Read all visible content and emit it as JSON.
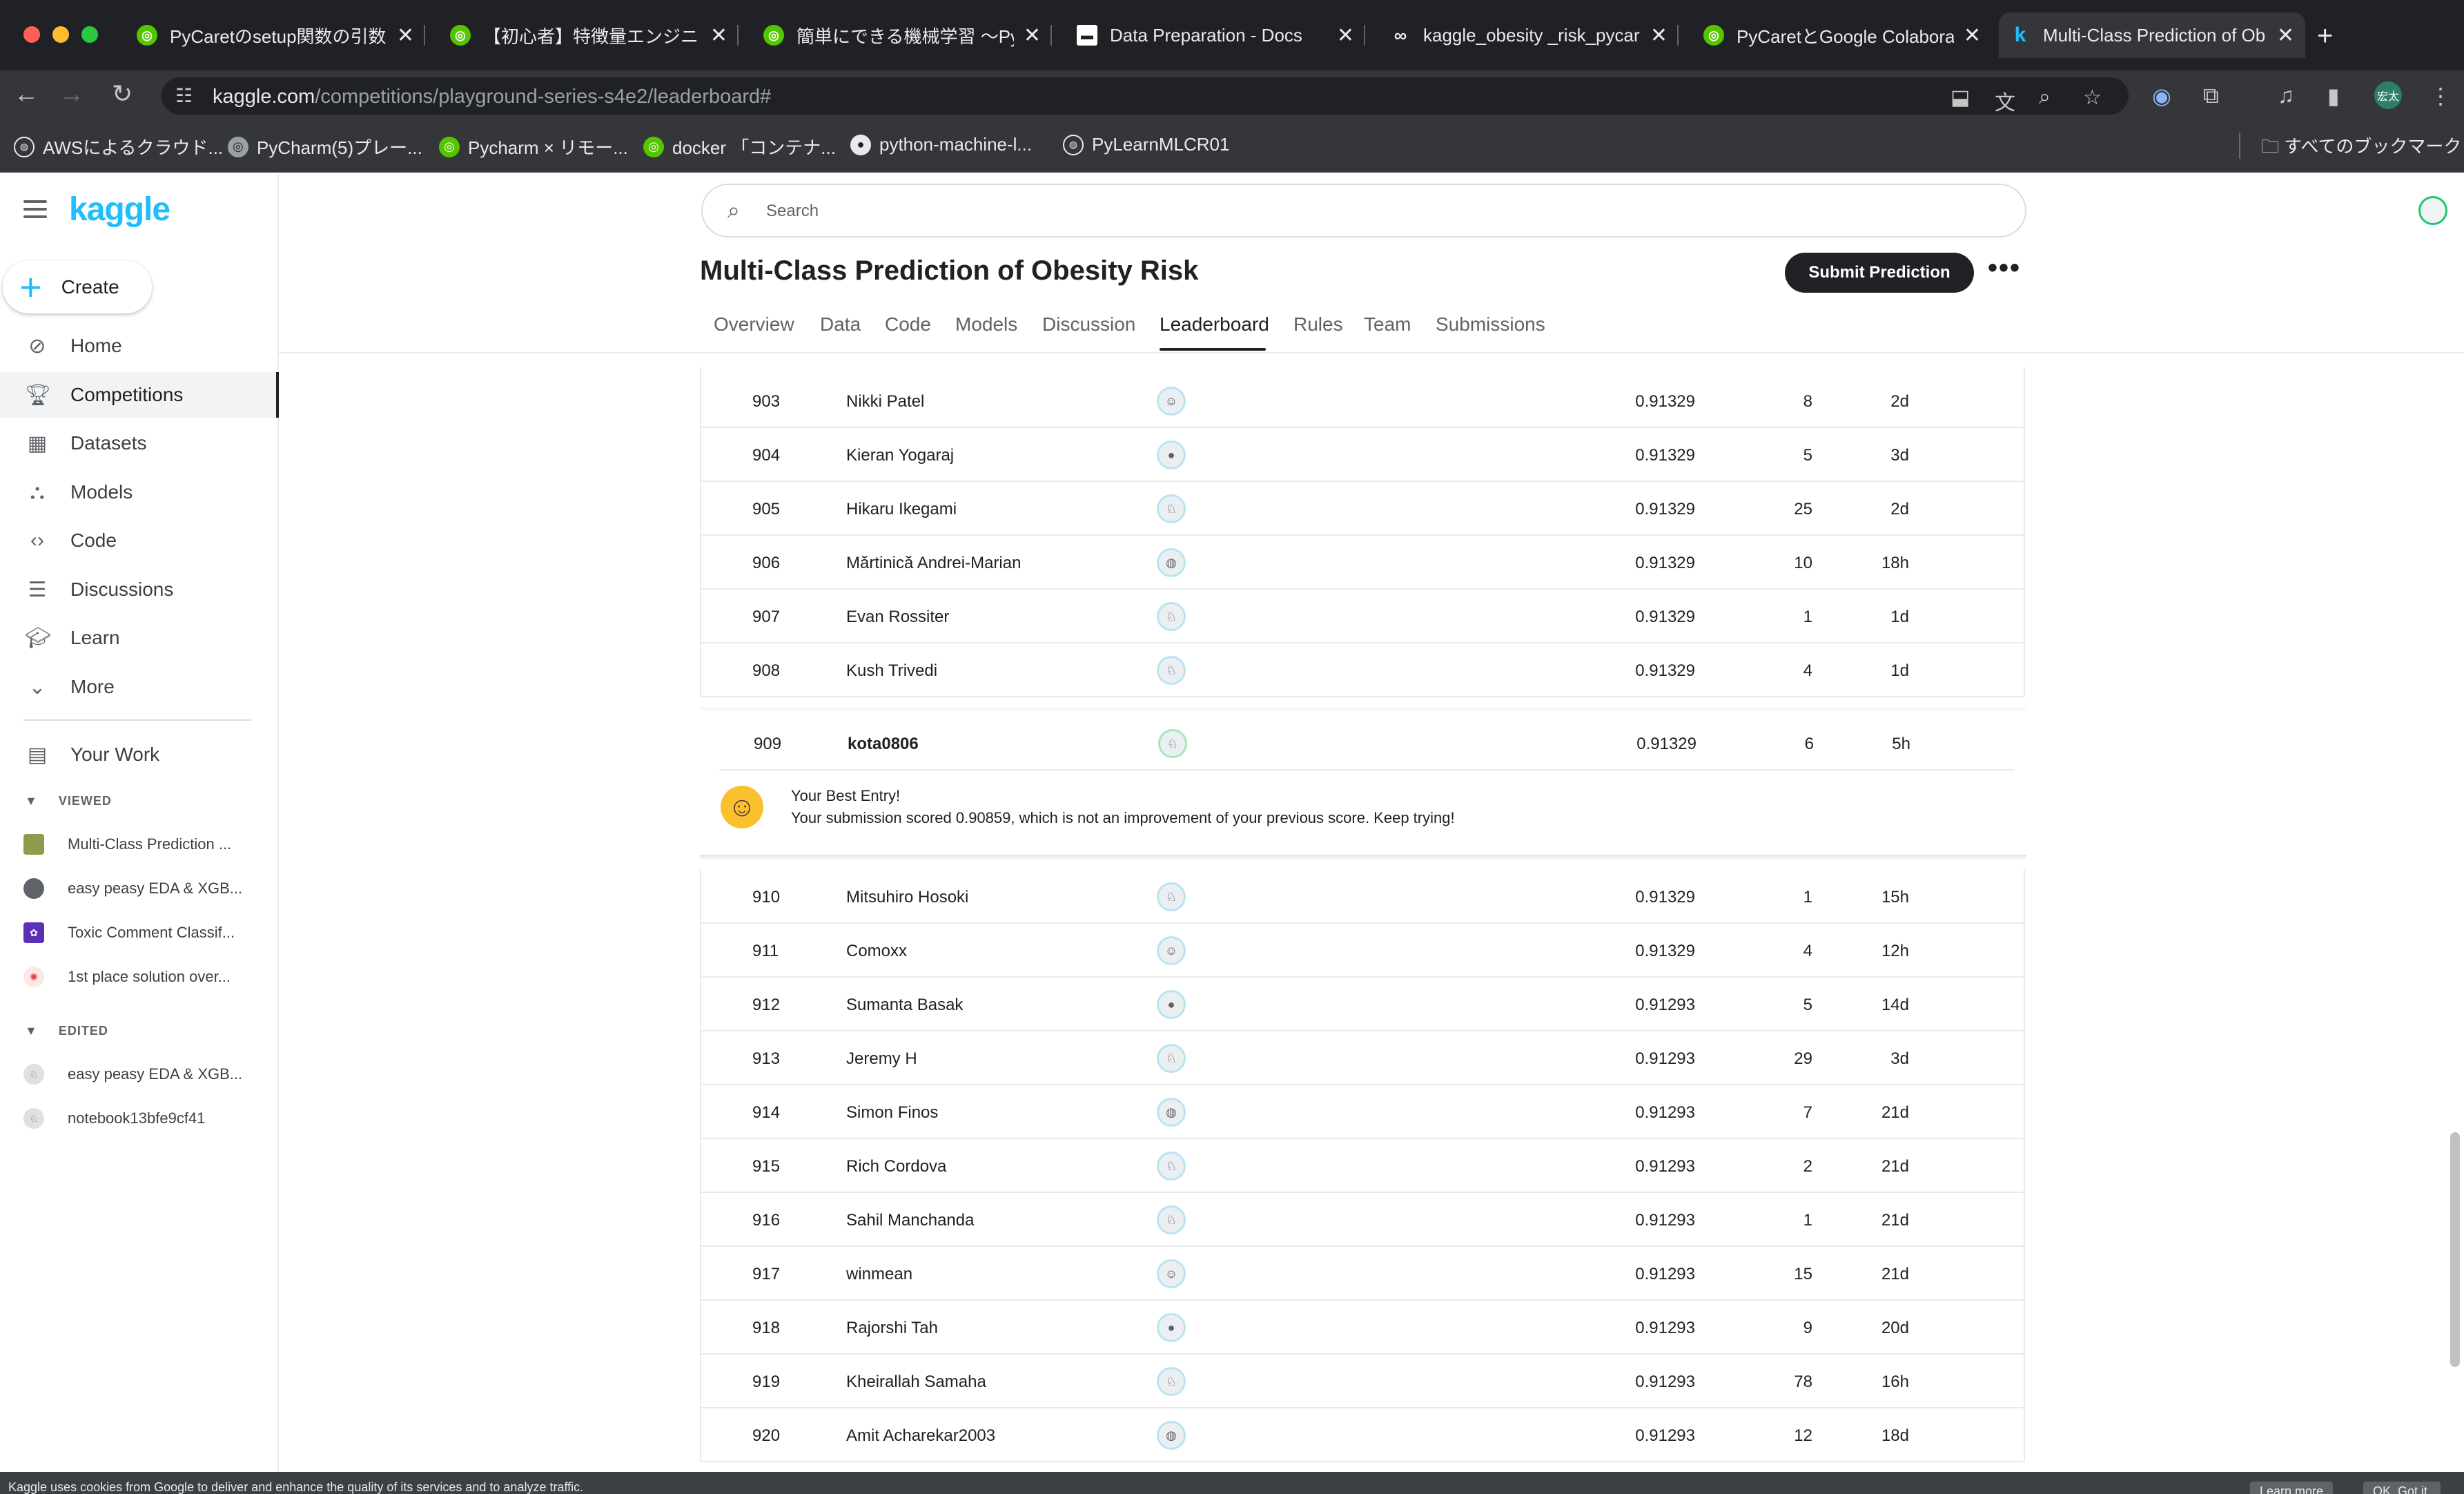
{
  "browser": {
    "tabs": [
      {
        "title": "PyCaretのsetup関数の引数に",
        "favicon": "green-circle"
      },
      {
        "title": "【初心者】特徴量エンジニアリ",
        "favicon": "green-circle"
      },
      {
        "title": "簡単にできる機械学習 〜PyCa",
        "favicon": "green-circle"
      },
      {
        "title": "Data Preparation - Docs",
        "favicon": "doc-square"
      },
      {
        "title": "kaggle_obesity _risk_pycar",
        "favicon": "colab-infinity"
      },
      {
        "title": "PyCaretとGoogle Colaborat",
        "favicon": "green-circle"
      },
      {
        "title": "Multi-Class Prediction of Ob",
        "favicon": "kaggle-k"
      }
    ],
    "url_host": "kaggle.com",
    "url_path": "/competitions/playground-series-s4e2/leaderboard#",
    "profile_initials": "宏太",
    "bookmarks": [
      {
        "label": "AWSによるクラウド..."
      },
      {
        "label": "PyCharm(5)プレー..."
      },
      {
        "label": "Pycharm × リモー..."
      },
      {
        "label": "docker 「コンテナ..."
      },
      {
        "label": "python-machine-l..."
      },
      {
        "label": "PyLearnMLCR01"
      }
    ],
    "all_bookmarks": "すべてのブックマーク"
  },
  "sidebar": {
    "logo": "kaggle",
    "create_label": "Create",
    "nav": [
      {
        "label": "Home",
        "icon": "compass-icon"
      },
      {
        "label": "Competitions",
        "icon": "trophy-icon"
      },
      {
        "label": "Datasets",
        "icon": "table-icon"
      },
      {
        "label": "Models",
        "icon": "models-icon"
      },
      {
        "label": "Code",
        "icon": "code-icon"
      },
      {
        "label": "Discussions",
        "icon": "discussion-icon"
      },
      {
        "label": "Learn",
        "icon": "learn-icon"
      },
      {
        "label": "More",
        "icon": "chevron-down-icon"
      }
    ],
    "your_work": "Your Work",
    "viewed_header": "VIEWED",
    "viewed": [
      "Multi-Class Prediction ...",
      "easy peasy EDA & XGB...",
      "Toxic Comment Classif...",
      "1st place solution over..."
    ],
    "edited_header": "EDITED",
    "edited": [
      "easy peasy EDA & XGB...",
      "notebook13bfe9cf41"
    ]
  },
  "header": {
    "search_placeholder": "Search",
    "title": "Multi-Class Prediction of Obesity Risk",
    "submit_label": "Submit Prediction",
    "more_label": "•••",
    "tabs": [
      "Overview",
      "Data",
      "Code",
      "Models",
      "Discussion",
      "Leaderboard",
      "Rules",
      "Team",
      "Submissions"
    ],
    "active_tab": "Leaderboard"
  },
  "leaderboard": {
    "rows_before": [
      {
        "rank": "903",
        "team": "Nikki Patel",
        "score": "0.91329",
        "entries": "8",
        "last": "2d"
      },
      {
        "rank": "904",
        "team": "Kieran Yogaraj",
        "score": "0.91329",
        "entries": "5",
        "last": "3d"
      },
      {
        "rank": "905",
        "team": "Hikaru Ikegami",
        "score": "0.91329",
        "entries": "25",
        "last": "2d"
      },
      {
        "rank": "906",
        "team": "Mărtinică Andrei-Marian",
        "score": "0.91329",
        "entries": "10",
        "last": "18h"
      },
      {
        "rank": "907",
        "team": "Evan Rossiter",
        "score": "0.91329",
        "entries": "1",
        "last": "1d"
      },
      {
        "rank": "908",
        "team": "Kush Trivedi",
        "score": "0.91329",
        "entries": "4",
        "last": "1d"
      }
    ],
    "my_entry": {
      "rank": "909",
      "team": "kota0806",
      "score": "0.91329",
      "entries": "6",
      "last": "5h",
      "best_label": "Your Best Entry!",
      "message": "Your submission scored 0.90859, which is not an improvement of your previous score. Keep trying!"
    },
    "rows_after": [
      {
        "rank": "910",
        "team": "Mitsuhiro Hosoki",
        "score": "0.91329",
        "entries": "1",
        "last": "15h"
      },
      {
        "rank": "911",
        "team": "Comoxx",
        "score": "0.91329",
        "entries": "4",
        "last": "12h"
      },
      {
        "rank": "912",
        "team": "Sumanta Basak",
        "score": "0.91293",
        "entries": "5",
        "last": "14d"
      },
      {
        "rank": "913",
        "team": "Jeremy H",
        "score": "0.91293",
        "entries": "29",
        "last": "3d"
      },
      {
        "rank": "914",
        "team": "Simon Finos",
        "score": "0.91293",
        "entries": "7",
        "last": "21d"
      },
      {
        "rank": "915",
        "team": "Rich Cordova",
        "score": "0.91293",
        "entries": "2",
        "last": "21d"
      },
      {
        "rank": "916",
        "team": "Sahil Manchanda",
        "score": "0.91293",
        "entries": "1",
        "last": "21d"
      },
      {
        "rank": "917",
        "team": "winmean",
        "score": "0.91293",
        "entries": "15",
        "last": "21d"
      },
      {
        "rank": "918",
        "team": "Rajorshi Tah",
        "score": "0.91293",
        "entries": "9",
        "last": "20d"
      },
      {
        "rank": "919",
        "team": "Kheirallah Samaha",
        "score": "0.91293",
        "entries": "78",
        "last": "16h"
      },
      {
        "rank": "920",
        "team": "Amit Acharekar2003",
        "score": "0.91293",
        "entries": "12",
        "last": "18d"
      }
    ]
  },
  "cookie": {
    "text": "Kaggle uses cookies from Google to deliver and enhance the quality of its services and to analyze traffic.",
    "learn_more": "Learn more",
    "ok": "OK, Got it."
  },
  "colors": {
    "kaggle_blue": "#20beff",
    "dark": "#202124",
    "chrome_bg": "#202124",
    "chrome_toolbar": "#35363a"
  }
}
